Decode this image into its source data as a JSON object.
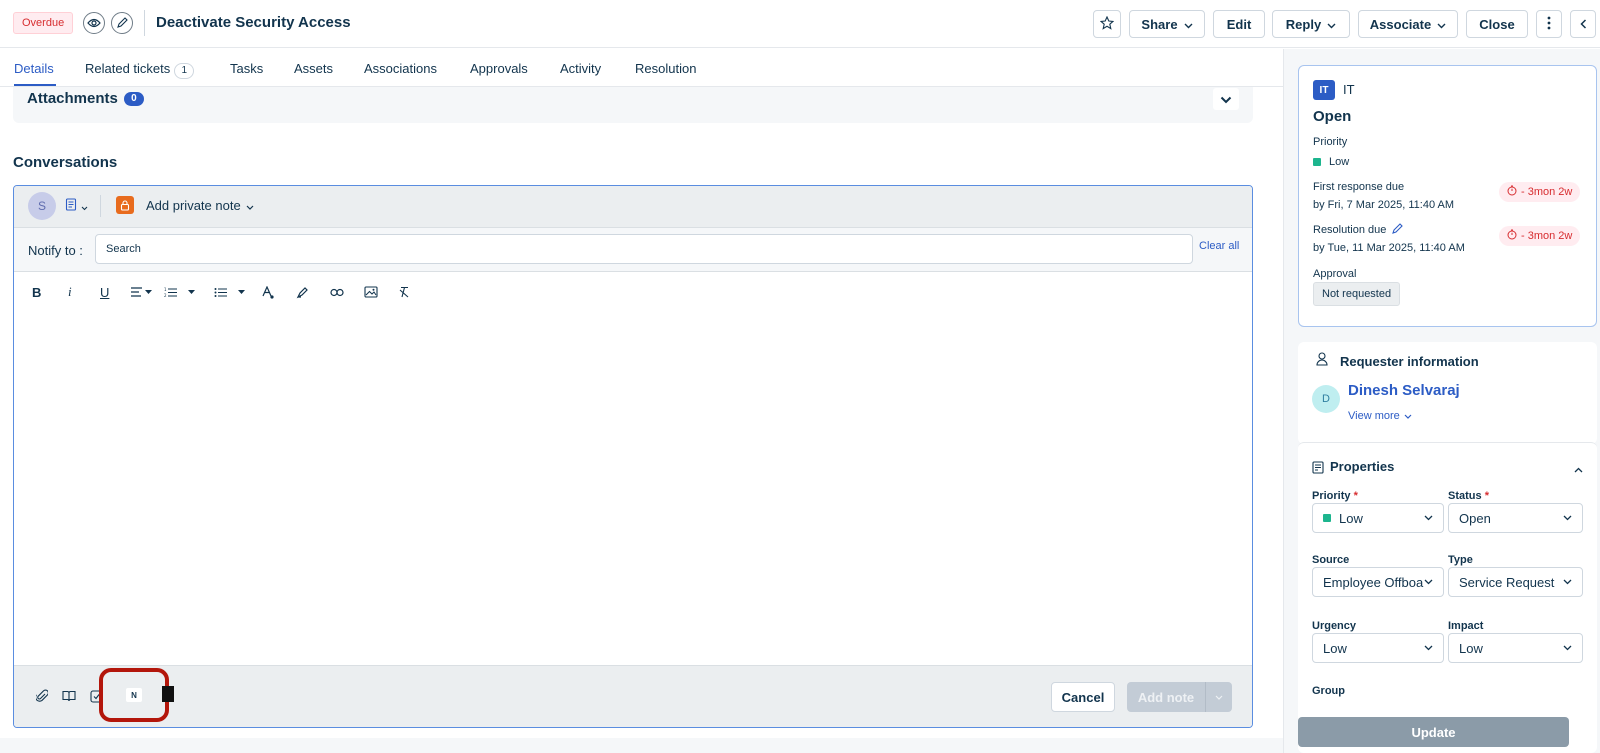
{
  "header": {
    "badge": "Overdue",
    "title": "Deactivate Security Access",
    "buttons": {
      "share": "Share",
      "edit": "Edit",
      "reply": "Reply",
      "associate": "Associate",
      "close": "Close"
    }
  },
  "tabs": [
    {
      "label": "Details"
    },
    {
      "label": "Related tickets",
      "count": "1"
    },
    {
      "label": "Tasks"
    },
    {
      "label": "Assets"
    },
    {
      "label": "Associations"
    },
    {
      "label": "Approvals"
    },
    {
      "label": "Activity"
    },
    {
      "label": "Resolution"
    }
  ],
  "main": {
    "attachments_label": "Attachments",
    "attachments_count": "0",
    "conversations_title": "Conversations",
    "editor": {
      "avatar_initial": "S",
      "note_type": "Add private note",
      "notify_label": "Notify to :",
      "search_placeholder": "Search",
      "clear_all": "Clear all",
      "n_chip": "N",
      "cancel": "Cancel",
      "add_note": "Add note"
    }
  },
  "sidebar": {
    "group_badge": "IT",
    "group_name": "IT",
    "status": "Open",
    "priority_label": "Priority",
    "priority_value": "Low",
    "first_response_label": "First response due",
    "first_response_value": "by Fri, 7 Mar 2025, 11:40 AM",
    "first_response_pill": "- 3mon 2w",
    "resolution_label": "Resolution due",
    "resolution_value": "by Tue, 11 Mar 2025, 11:40 AM",
    "resolution_pill": "- 3mon 2w",
    "approval_label": "Approval",
    "approval_value": "Not requested",
    "requester_title": "Requester information",
    "requester_initial": "D",
    "requester_name": "Dinesh Selvaraj",
    "view_more": "View more",
    "properties_title": "Properties",
    "fields": {
      "priority": {
        "label": "Priority",
        "value": "Low"
      },
      "status": {
        "label": "Status",
        "value": "Open"
      },
      "source": {
        "label": "Source",
        "value": "Employee Offboarding"
      },
      "type": {
        "label": "Type",
        "value": "Service Request"
      },
      "urgency": {
        "label": "Urgency",
        "value": "Low"
      },
      "impact": {
        "label": "Impact",
        "value": "Low"
      },
      "group": {
        "label": "Group"
      }
    },
    "update": "Update"
  },
  "colors": {
    "accent": "#2c5cc5",
    "overdue": "#d72d30",
    "priority_low": "#1db58e",
    "highlight": "#b3160b"
  }
}
